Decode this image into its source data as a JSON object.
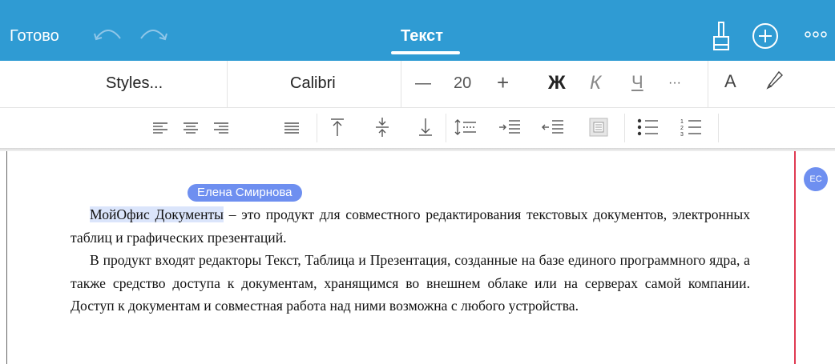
{
  "topbar": {
    "done_label": "Готово",
    "tab_title": "Текст",
    "icons": [
      "undo-icon",
      "redo-icon",
      "brush-icon",
      "plus-circle-icon",
      "more-icon"
    ]
  },
  "format_toolbar": {
    "styles_label": "Styles...",
    "font_name": "Calibri",
    "font_size": "20",
    "minus": "—",
    "plus": "+",
    "bold": "Ж",
    "italic": "К",
    "underline": "Ч",
    "ellipsis": "···",
    "font_color": "A"
  },
  "paragraph_toolbar": {
    "icons": [
      "align-left-icon",
      "align-center-icon",
      "align-right-icon",
      "align-justify-icon",
      "valign-top-icon",
      "valign-middle-icon",
      "valign-bottom-icon",
      "line-spacing-icon",
      "indent-increase-icon",
      "indent-decrease-icon",
      "cell-fill-icon",
      "bulleted-list-icon",
      "numbered-list-icon"
    ]
  },
  "document": {
    "collaborator_name": "Елена Смирнова",
    "collaborator_initials": "ЕС",
    "highlighted_text": "МойОфис Документы",
    "paragraph1_rest": " – это продукт для совместного редактирования текстовых документов, электронных таблиц и графических презентаций.",
    "paragraph2": "В продукт входят редакторы Текст, Таблица и Презентация, созданные на базе единого программного ядра, а также средство доступа к документам, хранящимся во внешнем облаке или на серверах самой компании. Доступ к документам и совместная работа над ними возможна с любого устройства."
  },
  "colors": {
    "topbar": "#2f9bd3",
    "collaborator": "#6e8ff0",
    "cursor_line": "#e03a52"
  }
}
